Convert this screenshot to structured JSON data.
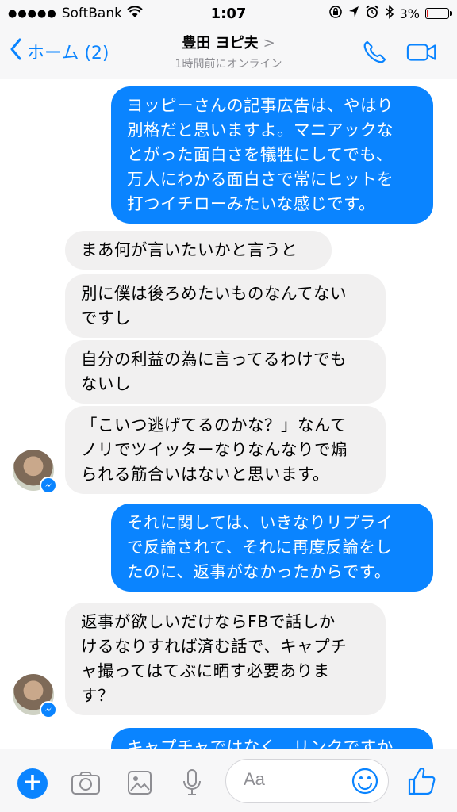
{
  "status_bar": {
    "signal": "●●●●●",
    "carrier": "SoftBank",
    "time": "1:07",
    "battery_text": "3%",
    "battery_level": 0.03
  },
  "header": {
    "back_label": "ホーム (2)",
    "contact_name": "豊田 ヨピ夫",
    "contact_chevron": ">",
    "presence": "1時間前にオンライン"
  },
  "messages": [
    {
      "side": "out",
      "lines": [
        "ヨッピーさんの記事広告は、やはり",
        "別格だと思いますよ。マニアックな",
        "とがった面白さを犠牲にしてでも、",
        "万人にわかる面白さで常にヒットを",
        "打つイチローみたいな感じです。"
      ]
    },
    {
      "side": "in",
      "lines": [
        "まあ何が言いたいかと言うと"
      ]
    },
    {
      "side": "in",
      "lines": [
        "別に僕は後ろめたいものなんてない",
        "ですし"
      ]
    },
    {
      "side": "in",
      "lines": [
        "自分の利益の為に言ってるわけでも",
        "ないし"
      ]
    },
    {
      "side": "in",
      "lines": [
        "「こいつ逃げてるのかな？」なんて",
        "ノリでツイッターなりなんなりで煽",
        "られる筋合いはないと思います。"
      ]
    },
    {
      "side": "out",
      "lines": [
        "それに関しては、いきなりリプライ",
        "で反論されて、それに再度反論をし",
        "たのに、返事がなかったからです。"
      ]
    },
    {
      "side": "in",
      "lines": [
        "返事が欲しいだけならFBで話しか",
        "けるなりすれば済む話で、キャプチ",
        "ャ撮ってはてぶに晒す必要ありま",
        "す？"
      ]
    },
    {
      "side": "out",
      "lines": [
        "キャプチャではなく、リンクですか"
      ]
    }
  ],
  "composer": {
    "placeholder": "Aa"
  },
  "colors": {
    "accent": "#0a84ff",
    "incoming_bubble": "#f1f0f0",
    "battery_low": "#e02424"
  },
  "icons": [
    "wifi-icon",
    "lock-rotation-icon",
    "location-icon",
    "alarm-icon",
    "bluetooth-icon",
    "battery-icon",
    "back-chevron-icon",
    "phone-icon",
    "video-icon",
    "plus-icon",
    "camera-icon",
    "image-icon",
    "microphone-icon",
    "emoji-icon",
    "thumbs-up-icon",
    "messenger-badge-icon"
  ]
}
